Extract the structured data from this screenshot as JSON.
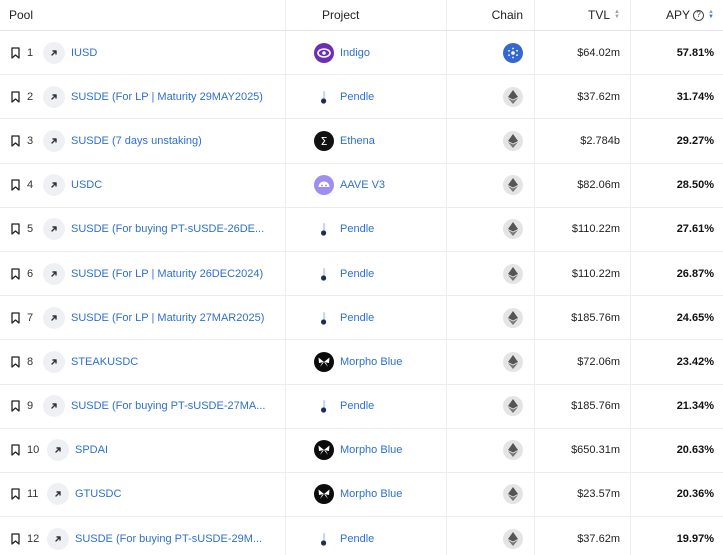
{
  "header": {
    "pool": "Pool",
    "project": "Project",
    "chain": "Chain",
    "tvl": "TVL",
    "apy": "APY",
    "apy_info": "?"
  },
  "rows": [
    {
      "rank": "1",
      "pool": "IUSD",
      "project": "Indigo",
      "project_icon": "indigo-icon",
      "chain": "cardano-icon",
      "tvl": "$64.02m",
      "apy": "57.81%"
    },
    {
      "rank": "2",
      "pool": "SUSDE (For LP | Maturity 29MAY2025)",
      "project": "Pendle",
      "project_icon": "pendle-icon",
      "chain": "ethereum-icon",
      "tvl": "$37.62m",
      "apy": "31.74%"
    },
    {
      "rank": "3",
      "pool": "SUSDE (7 days unstaking)",
      "project": "Ethena",
      "project_icon": "ethena-icon",
      "chain": "ethereum-icon",
      "tvl": "$2.784b",
      "apy": "29.27%"
    },
    {
      "rank": "4",
      "pool": "USDC",
      "project": "AAVE V3",
      "project_icon": "aave-icon",
      "chain": "ethereum-icon",
      "tvl": "$82.06m",
      "apy": "28.50%"
    },
    {
      "rank": "5",
      "pool": "SUSDE (For buying PT-sUSDE-26DE...",
      "project": "Pendle",
      "project_icon": "pendle-icon",
      "chain": "ethereum-icon",
      "tvl": "$110.22m",
      "apy": "27.61%"
    },
    {
      "rank": "6",
      "pool": "SUSDE (For LP | Maturity 26DEC2024)",
      "project": "Pendle",
      "project_icon": "pendle-icon",
      "chain": "ethereum-icon",
      "tvl": "$110.22m",
      "apy": "26.87%"
    },
    {
      "rank": "7",
      "pool": "SUSDE (For LP | Maturity 27MAR2025)",
      "project": "Pendle",
      "project_icon": "pendle-icon",
      "chain": "ethereum-icon",
      "tvl": "$185.76m",
      "apy": "24.65%"
    },
    {
      "rank": "8",
      "pool": "STEAKUSDC",
      "project": "Morpho Blue",
      "project_icon": "morpho-icon",
      "chain": "ethereum-icon",
      "tvl": "$72.06m",
      "apy": "23.42%"
    },
    {
      "rank": "9",
      "pool": "SUSDE (For buying PT-sUSDE-27MA...",
      "project": "Pendle",
      "project_icon": "pendle-icon",
      "chain": "ethereum-icon",
      "tvl": "$185.76m",
      "apy": "21.34%"
    },
    {
      "rank": "10",
      "pool": "SPDAI",
      "project": "Morpho Blue",
      "project_icon": "morpho-icon",
      "chain": "ethereum-icon",
      "tvl": "$650.31m",
      "apy": "20.63%"
    },
    {
      "rank": "11",
      "pool": "GTUSDC",
      "project": "Morpho Blue",
      "project_icon": "morpho-icon",
      "chain": "ethereum-icon",
      "tvl": "$23.57m",
      "apy": "20.36%"
    },
    {
      "rank": "12",
      "pool": "SUSDE (For buying PT-sUSDE-29M...",
      "project": "Pendle",
      "project_icon": "pendle-icon",
      "chain": "ethereum-icon",
      "tvl": "$37.62m",
      "apy": "19.97%"
    }
  ],
  "colors": {
    "link": "#2d6fd2",
    "sort_active": "#2f7bd8",
    "indigo": "#6b2fb3",
    "aave": "#9d8ef0",
    "cardano": "#3468d1"
  }
}
